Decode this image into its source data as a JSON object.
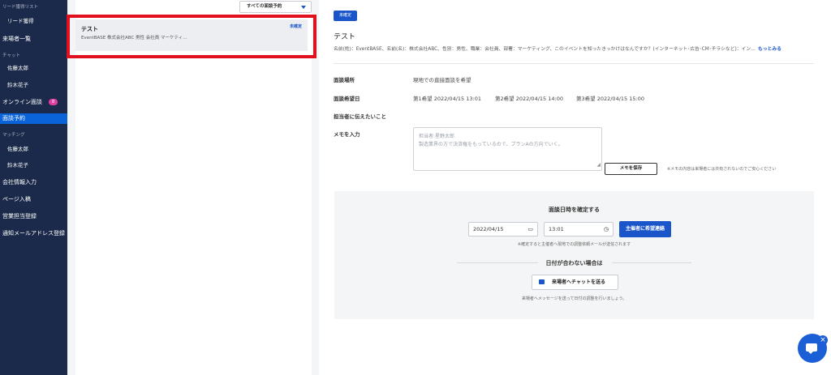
{
  "sidebar": {
    "items": [
      {
        "label": "リード獲得リスト",
        "kind": "section"
      },
      {
        "label": "リード獲得",
        "kind": "sub"
      },
      {
        "label": "来場者一覧",
        "kind": "main"
      },
      {
        "label": "チャット",
        "kind": "section"
      },
      {
        "label": "佐藤太郎",
        "kind": "sub"
      },
      {
        "label": "鈴木花子",
        "kind": "sub"
      },
      {
        "label": "オンライン面談",
        "kind": "main",
        "badge": "8"
      },
      {
        "label": "面談予約",
        "kind": "main",
        "active": true
      },
      {
        "label": "マッチング",
        "kind": "section"
      },
      {
        "label": "佐藤太郎",
        "kind": "sub"
      },
      {
        "label": "鈴木花子",
        "kind": "sub"
      },
      {
        "label": "会社情報入力",
        "kind": "main"
      },
      {
        "label": "ページ入稿",
        "kind": "main"
      },
      {
        "label": "営業担当登録",
        "kind": "main"
      },
      {
        "label": "通知メールアドレス登録",
        "kind": "main"
      }
    ]
  },
  "list": {
    "filter": "すべての面談予約",
    "card": {
      "title": "テスト",
      "status": "未確定",
      "detail": "EventBASE  株式会社ABC  男性  会社員  マーケティ…"
    }
  },
  "detail": {
    "status_button": "未確定",
    "title": "テスト",
    "profile": "名前(姓)：EventBASE、名前(名)：株式会社ABC、性別：男性、職業：会社員、部署：マーケティング、このイベントを知ったきっかけはなんですか？(インターネット･広告･CM･チラシなど)：イン…",
    "more_link": "もっとみる",
    "place_label": "面談場所",
    "place_value": "現地での直接面談を希望",
    "wish_label": "面談希望日",
    "wish1": "第1希望 2022/04/15 13:01",
    "wish2": "第2希望 2022/04/15 14:00",
    "wish3": "第3希望 2022/04/15 15:00",
    "message_label": "担当者に伝えたいこと",
    "memo_label": "メモを入力",
    "memo_placeholder_1": "担当者:星野太郎",
    "memo_placeholder_2": "製造業界の方で決済権をもっているので、プランAの方向でいく。",
    "save_button": "メモを保存",
    "memo_note": "※メモの内容は来場者には共有されないのでご安心ください"
  },
  "confirm": {
    "title": "面談日時を確定する",
    "date_value": "2022/04/15",
    "time_value": "13:01",
    "submit_button": "主催者に希望連絡",
    "submit_note": "※確定すると主催者へ現地での調整依頼メールが送信されます",
    "alt_title": "日付が合わない場合は",
    "chat_button": "来場者へチャットを送る",
    "alt_note": "来場者へメッセージを送って日付の調整を行いましょう。"
  },
  "colors": {
    "sidebar_bg": "#1b2a4a",
    "accent": "#1a56c9",
    "highlight": "#e0101e",
    "badge": "#e13ea0"
  },
  "icons": {
    "filter": "chevron-down-icon",
    "date": "calendar-icon",
    "time": "clock-icon",
    "chat": "chat-bubble-icon",
    "fab": "chat-support-icon",
    "fab_close": "close-icon"
  }
}
